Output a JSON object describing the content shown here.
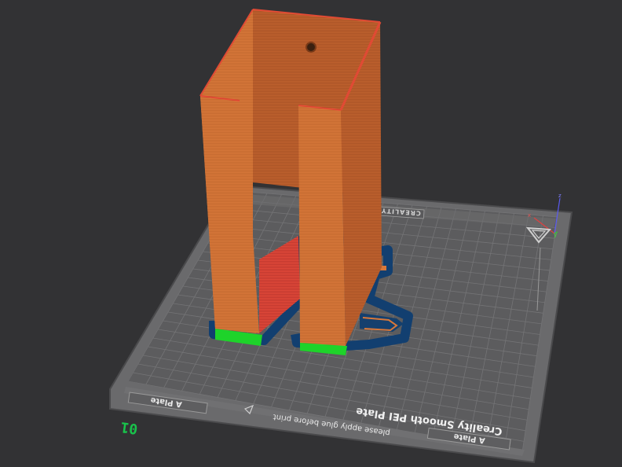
{
  "plate": {
    "number": "01",
    "title": "Creality Smooth PEI Plate",
    "notice": "please apply glue before print",
    "side_labels": [
      "A Plate",
      "A Plate"
    ],
    "brand": "CREALITY"
  },
  "axes": {
    "x": "x",
    "y": "y",
    "z": "z"
  },
  "colors": {
    "background": "#323234",
    "bed": "#5a5a5c",
    "grid": "#707072",
    "model_wall": "#d8783a",
    "model_inner": "#c0622e",
    "overhang": "#d83a2f",
    "first_layer": "#1ed32a",
    "skirt": "#15406e"
  }
}
